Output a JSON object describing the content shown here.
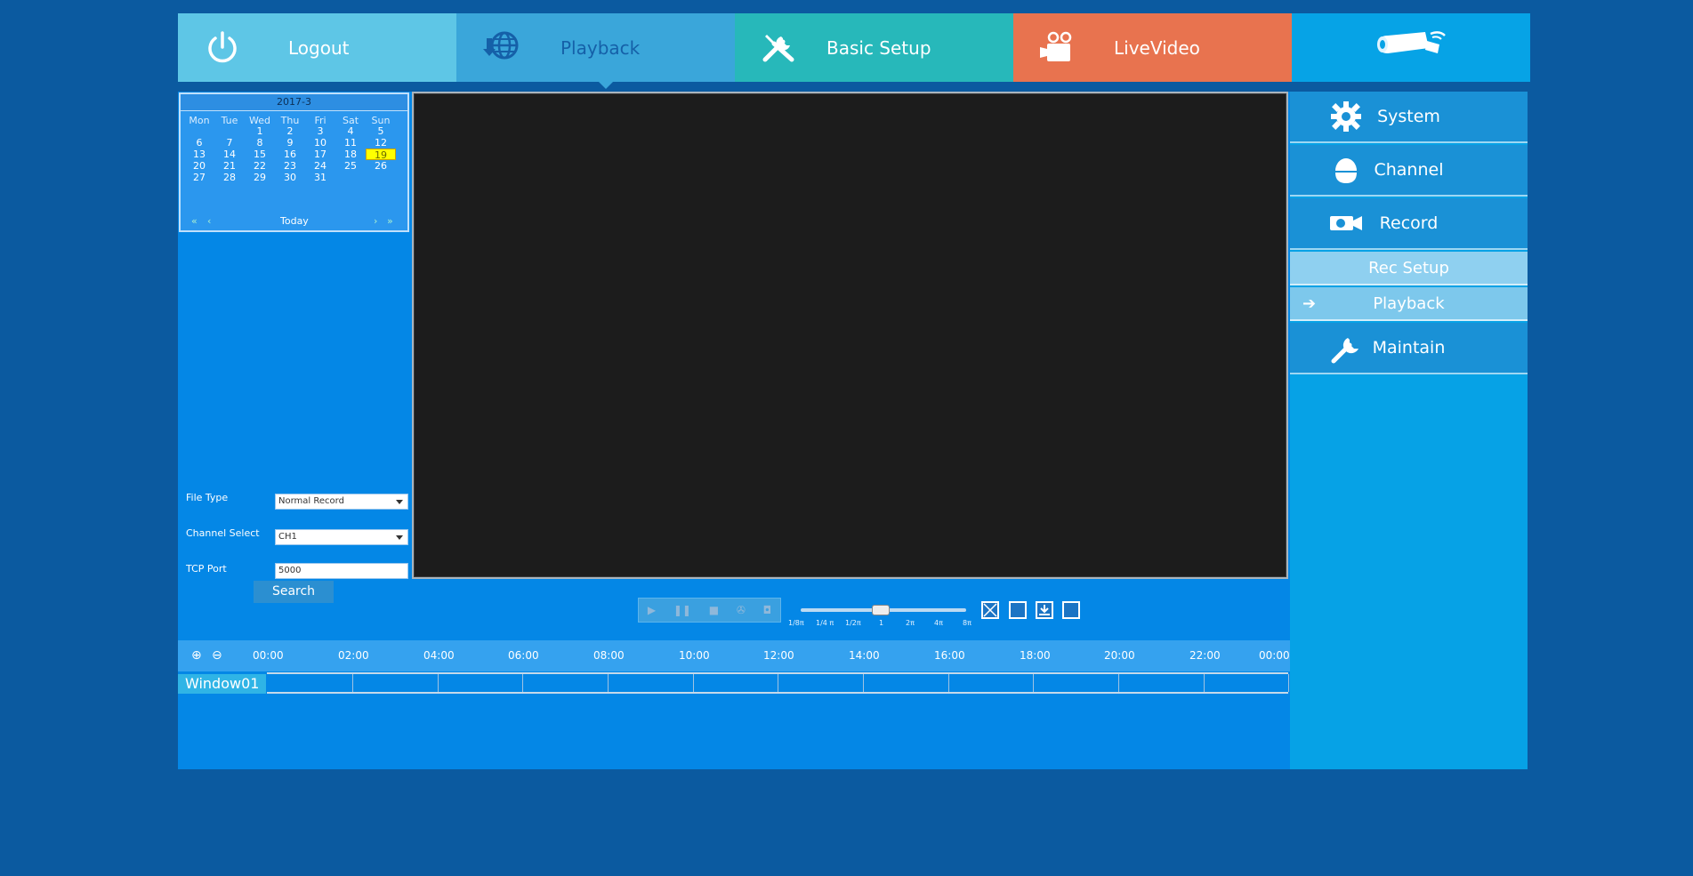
{
  "nav": {
    "logout": "Logout",
    "playback": "Playback",
    "basic_setup": "Basic Setup",
    "livevideo": "LiveVideo"
  },
  "calendar": {
    "month": "2017-3",
    "dow": [
      "Mon",
      "Tue",
      "Wed",
      "Thu",
      "Fri",
      "Sat",
      "Sun"
    ],
    "weeks": [
      [
        "",
        "",
        "1",
        "2",
        "3",
        "4",
        "5"
      ],
      [
        "6",
        "7",
        "8",
        "9",
        "10",
        "11",
        "12"
      ],
      [
        "13",
        "14",
        "15",
        "16",
        "17",
        "18",
        "19"
      ],
      [
        "20",
        "21",
        "22",
        "23",
        "24",
        "25",
        "26"
      ],
      [
        "27",
        "28",
        "29",
        "30",
        "31",
        "",
        ""
      ]
    ],
    "selected": "19",
    "prev_year": "«",
    "prev_month": "‹",
    "today": "Today",
    "next_month": "›",
    "next_year": "»"
  },
  "form": {
    "file_type_label": "File Type",
    "file_type_value": "Normal Record",
    "channel_label": "Channel Select",
    "channel_value": "CH1",
    "tcp_label": "TCP Port",
    "tcp_value": "5000",
    "search_label": "Search"
  },
  "speed": {
    "labels": [
      "1/8π",
      "1/4 π",
      "1/2π",
      "1",
      "2π",
      "4π",
      "8π"
    ],
    "current": "1"
  },
  "timeline": {
    "times": [
      "00:00",
      "02:00",
      "04:00",
      "06:00",
      "08:00",
      "10:00",
      "12:00",
      "14:00",
      "16:00",
      "18:00",
      "20:00",
      "22:00",
      "00:00"
    ],
    "window_label": "Window01"
  },
  "sidebar": {
    "system": "System",
    "channel": "Channel",
    "record": "Record",
    "rec_setup": "Rec Setup",
    "playback": "Playback",
    "maintain": "Maintain"
  },
  "icons": {
    "logout": "power-icon",
    "playback": "globe-download-icon",
    "basic_setup": "tools-icon",
    "livevideo": "video-camera-icon",
    "logo": "bullet-camera-icon",
    "system": "gear-icon",
    "channel": "dome-camera-icon",
    "record": "record-camera-icon",
    "maintain": "wrench-icon",
    "arrow": "arrow-right-icon"
  },
  "colors": {
    "background": "#0b5aa0",
    "logout_tab": "#5ec6e6",
    "playback_tab": "#3aa6da",
    "basic_setup_tab": "#27b8ba",
    "livevideo_tab": "#e8734f",
    "logo_tab": "#06a3e6",
    "selected_day": "#ffff00"
  }
}
